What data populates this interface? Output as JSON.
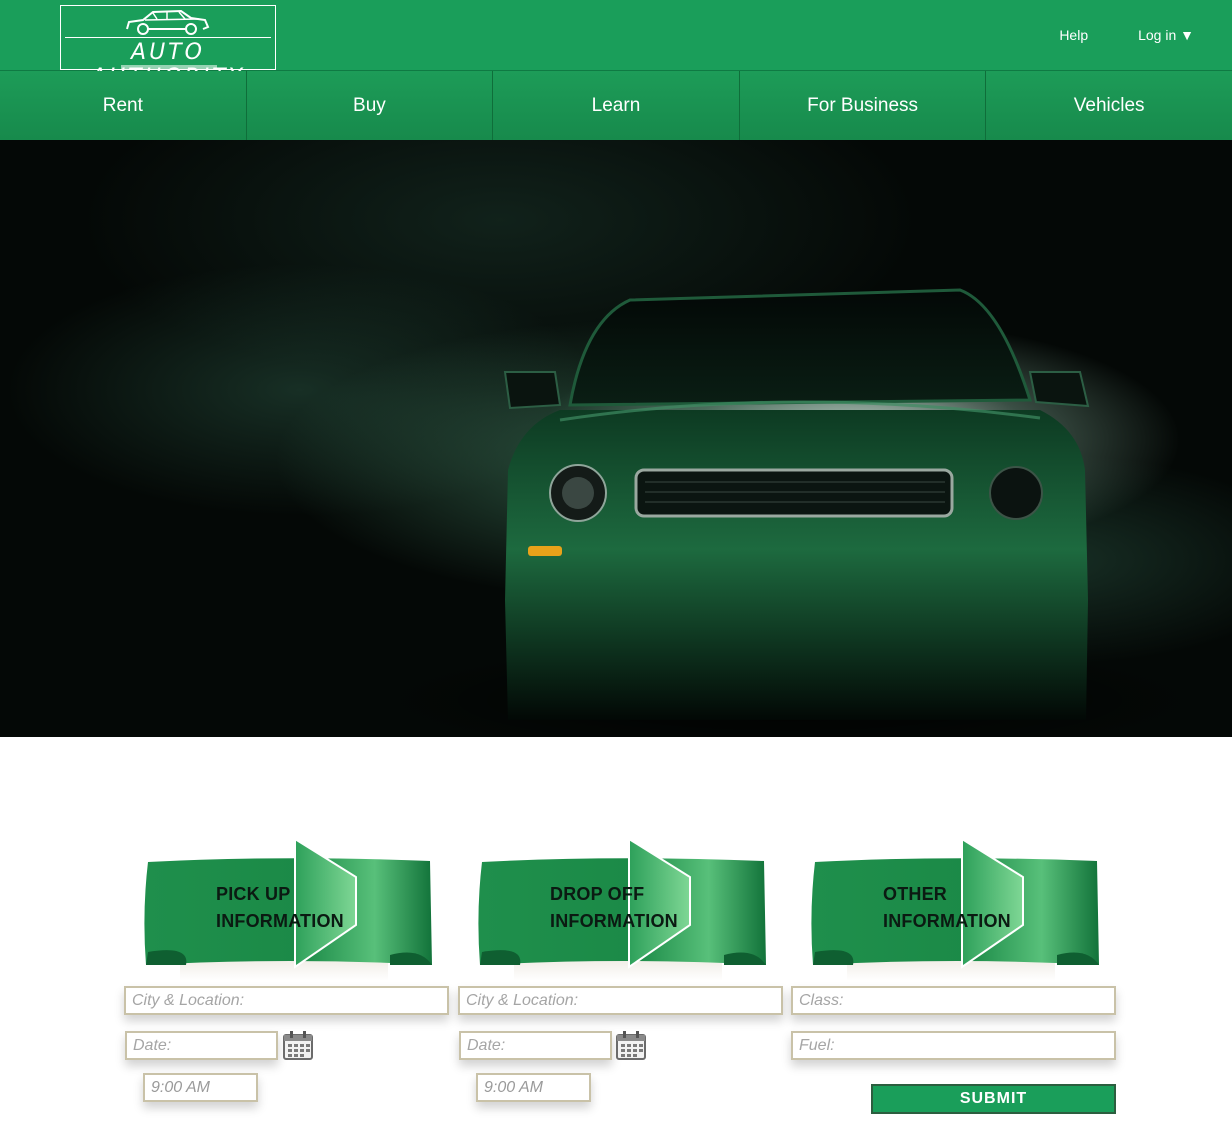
{
  "header": {
    "logo_text": "AUTO AUTHORITY",
    "help_label": "Help",
    "login_label": "Log in ▼"
  },
  "nav": {
    "items": [
      {
        "label": "Rent"
      },
      {
        "label": "Buy"
      },
      {
        "label": "Learn"
      },
      {
        "label": "For Business"
      },
      {
        "label": "Vehicles"
      }
    ]
  },
  "hero": {
    "image": "green-muscle-car-in-smoke"
  },
  "form": {
    "pickup": {
      "title_line1": "PICK UP",
      "title_line2": "INFORMATION",
      "city_placeholder": "City & Location:",
      "date_placeholder": "Date:",
      "time_value": "9:00 AM"
    },
    "dropoff": {
      "title_line1": "DROP OFF",
      "title_line2": "INFORMATION",
      "city_placeholder": "City & Location:",
      "date_placeholder": "Date:",
      "time_value": "9:00 AM"
    },
    "other": {
      "title_line1": "OTHER",
      "title_line2": "INFORMATION",
      "class_placeholder": "Class:",
      "fuel_placeholder": "Fuel:"
    },
    "submit_label": "SUBMIT"
  },
  "colors": {
    "brand_green": "#1a9e5a",
    "nav_border": "#0f6e3a",
    "field_border": "#c9c2a8"
  }
}
